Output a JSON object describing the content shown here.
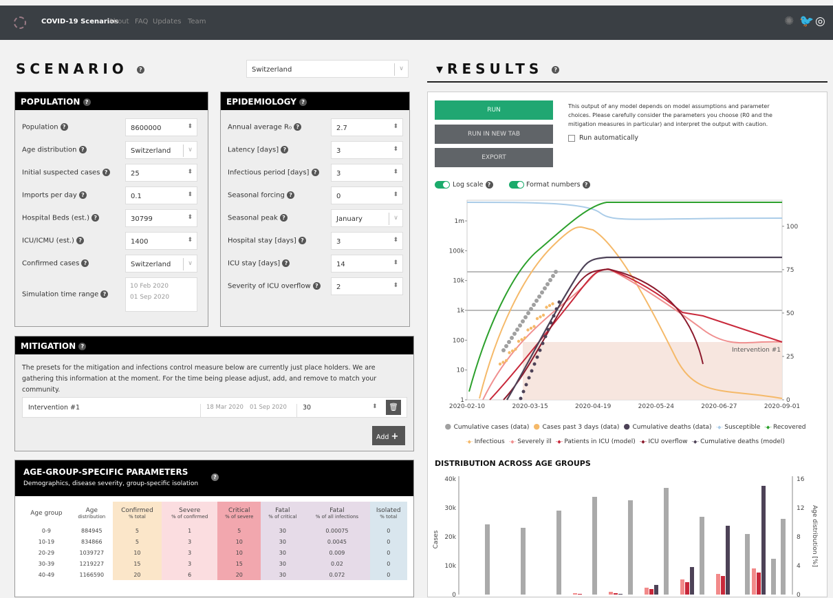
{
  "nav": {
    "brand": "COVID-19 Scenarios",
    "links": [
      "About",
      "FAQ",
      "Updates",
      "Team"
    ]
  },
  "scenario": {
    "title": "SCENARIO",
    "selected": "Switzerland"
  },
  "results": {
    "title": "RESULTS",
    "run": "RUN",
    "run_new_tab": "RUN IN NEW TAB",
    "export": "EXPORT",
    "disclaimer": "This output of any model depends on model assumptions and parameter choices. Please carefully consider the parameters you choose (R0 and the mitigation measures in particular) and interpret the output with caution.",
    "run_auto": "Run automatically",
    "log_scale": "Log scale",
    "format_numbers": "Format numbers"
  },
  "population": {
    "title": "POPULATION",
    "fields": [
      {
        "label": "Population",
        "value": "8600000"
      },
      {
        "label": "Age distribution",
        "value": "Switzerland"
      },
      {
        "label": "Initial suspected cases",
        "value": "25"
      },
      {
        "label": "Imports per day",
        "value": "0.1"
      },
      {
        "label": "Hospital Beds (est.)",
        "value": "30799"
      },
      {
        "label": "ICU/ICMU (est.)",
        "value": "1400"
      },
      {
        "label": "Confirmed cases",
        "value": "Switzerland"
      },
      {
        "label": "Simulation time range",
        "value": "10 Feb 2020",
        "value2": "01 Sep 2020"
      }
    ]
  },
  "epidemiology": {
    "title": "EPIDEMIOLOGY",
    "fields": [
      {
        "label": "Annual average R₀",
        "value": "2.7"
      },
      {
        "label": "Latency [days]",
        "value": "3"
      },
      {
        "label": "Infectious period [days]",
        "value": "3"
      },
      {
        "label": "Seasonal forcing",
        "value": "0"
      },
      {
        "label": "Seasonal peak",
        "value": "January"
      },
      {
        "label": "Hospital stay [days]",
        "value": "3"
      },
      {
        "label": "ICU stay [days]",
        "value": "14"
      },
      {
        "label": "Severity of ICU overflow",
        "value": "2"
      }
    ]
  },
  "mitigation": {
    "title": "MITIGATION",
    "text": "The presets for the mitigation and infections control measure below are currently just place holders. We are gathering this information at the moment. For the time being please adjust, add, and remove to match your community.",
    "name": "Intervention #1",
    "from": "18 Mar 2020",
    "to": "01 Sep 2020",
    "value": "30",
    "add": "Add"
  },
  "agegroup": {
    "title": "AGE-GROUP-SPECIFIC PARAMETERS",
    "subtitle": "Demographics, disease severity, group-specific isolation",
    "headers": [
      [
        "Age group",
        ""
      ],
      [
        "Age",
        "distribution"
      ],
      [
        "Confirmed",
        "% total"
      ],
      [
        "Severe",
        "% of confirmed"
      ],
      [
        "Critical",
        "% of severe"
      ],
      [
        "Fatal",
        "% of critical"
      ],
      [
        "Fatal",
        "% of all infections"
      ],
      [
        "Isolated",
        "% total"
      ]
    ],
    "rows": [
      [
        "0-9",
        "884945",
        "5",
        "1",
        "5",
        "30",
        "0.00075",
        "0"
      ],
      [
        "10-19",
        "834866",
        "5",
        "3",
        "10",
        "30",
        "0.0045",
        "0"
      ],
      [
        "20-29",
        "1039727",
        "10",
        "3",
        "10",
        "30",
        "0.009",
        "0"
      ],
      [
        "30-39",
        "1219227",
        "15",
        "3",
        "15",
        "30",
        "0.02",
        "0"
      ],
      [
        "40-49",
        "1166590",
        "20",
        "6",
        "20",
        "30",
        "0.072",
        "0"
      ]
    ]
  },
  "chart_data": [
    {
      "type": "line",
      "x_ticks": [
        "2020-02-10",
        "2020-03-15",
        "2020-04-19",
        "2020-05-24",
        "2020-06-27",
        "2020-09-01"
      ],
      "y_ticks": [
        "1",
        "10",
        "100",
        "1k",
        "10k",
        "100k",
        "1m"
      ],
      "y2_ticks": [
        "0",
        "25",
        "50",
        "75",
        "100"
      ],
      "log_scale": true,
      "annotation": "Intervention #1",
      "legend": [
        "Cumulative cases (data)",
        "Cases past 3 days (data)",
        "Cumulative deaths (data)",
        "Susceptible",
        "Recovered",
        "Infectious",
        "Severely ill",
        "Patients in ICU (model)",
        "ICU overflow",
        "Cumulative deaths (model)"
      ],
      "colors": {
        "recovered": "#2ca02c",
        "susceptible": "#aacce8",
        "infectious": "#f5b969",
        "severe": "#f08f8f",
        "icu": "#c8283a",
        "overflow": "#8b1a2d",
        "deaths": "#4d4257",
        "cases": "#a0a0a0"
      }
    },
    {
      "type": "bar",
      "title": "DISTRIBUTION ACROSS AGE GROUPS",
      "ylabel": "Cases",
      "y2label": "Age distribution [%]",
      "y_ticks": [
        "0",
        "10k",
        "20k",
        "30k",
        "40k"
      ],
      "y2_ticks": [
        "0",
        "4",
        "8",
        "12",
        "16"
      ]
    }
  ]
}
